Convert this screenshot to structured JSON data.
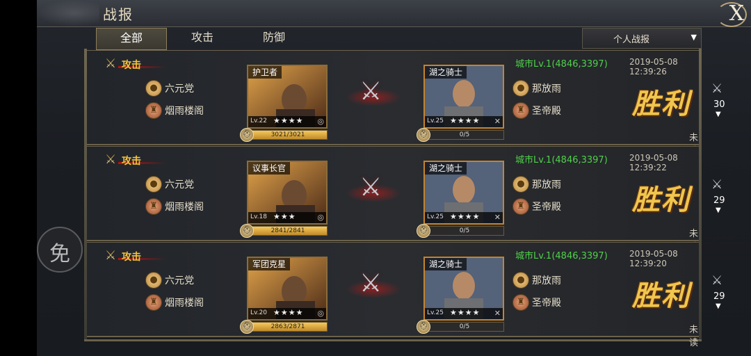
{
  "header": {
    "title": "战报",
    "close_label": "X"
  },
  "left_handle": {
    "label": "免"
  },
  "tabs": [
    {
      "label": "全部"
    },
    {
      "label": "攻击"
    },
    {
      "label": "防御"
    }
  ],
  "filter": {
    "label": "个人战报",
    "arrow": "▼"
  },
  "colors": {
    "accent": "#f0c64d",
    "city": "#4fd14a",
    "attack": "#f3c43e"
  },
  "reports": [
    {
      "type_label": "攻击",
      "attacker": {
        "name": "六元党",
        "alliance": "烟雨楼阁"
      },
      "attacker_hero": {
        "name": "护卫者",
        "level": "Lv.22",
        "stars": "★★★★",
        "troops": "3021/3021",
        "troops_fraction": 1.0
      },
      "defender_hero": {
        "name": "湖之骑士",
        "level": "Lv.25",
        "stars": "★★★★",
        "troops": "0/5",
        "troops_fraction": 0.0
      },
      "defender": {
        "name": "那放雨",
        "alliance": "圣帝殿"
      },
      "location": "城市Lv.1(4846,3397)",
      "time": "2019-05-08 12:39:26",
      "result": "胜利",
      "status": "未读",
      "count": "30"
    },
    {
      "type_label": "攻击",
      "attacker": {
        "name": "六元党",
        "alliance": "烟雨楼阁"
      },
      "attacker_hero": {
        "name": "议事长官",
        "level": "Lv.18",
        "stars": "★★★",
        "troops": "2841/2841",
        "troops_fraction": 1.0
      },
      "defender_hero": {
        "name": "湖之骑士",
        "level": "Lv.25",
        "stars": "★★★★",
        "troops": "0/5",
        "troops_fraction": 0.0
      },
      "defender": {
        "name": "那放雨",
        "alliance": "圣帝殿"
      },
      "location": "城市Lv.1(4846,3397)",
      "time": "2019-05-08 12:39:22",
      "result": "胜利",
      "status": "未读",
      "count": "29"
    },
    {
      "type_label": "攻击",
      "attacker": {
        "name": "六元党",
        "alliance": "烟雨楼阁"
      },
      "attacker_hero": {
        "name": "军团克星",
        "level": "Lv.20",
        "stars": "★★★★",
        "troops": "2863/2871",
        "troops_fraction": 0.997
      },
      "defender_hero": {
        "name": "湖之骑士",
        "level": "Lv.25",
        "stars": "★★★★",
        "troops": "0/5",
        "troops_fraction": 0.0
      },
      "defender": {
        "name": "那放雨",
        "alliance": "圣帝殿"
      },
      "location": "城市Lv.1(4846,3397)",
      "time": "2019-05-08 12:39:20",
      "result": "胜利",
      "status": "未读",
      "count": "29"
    }
  ]
}
